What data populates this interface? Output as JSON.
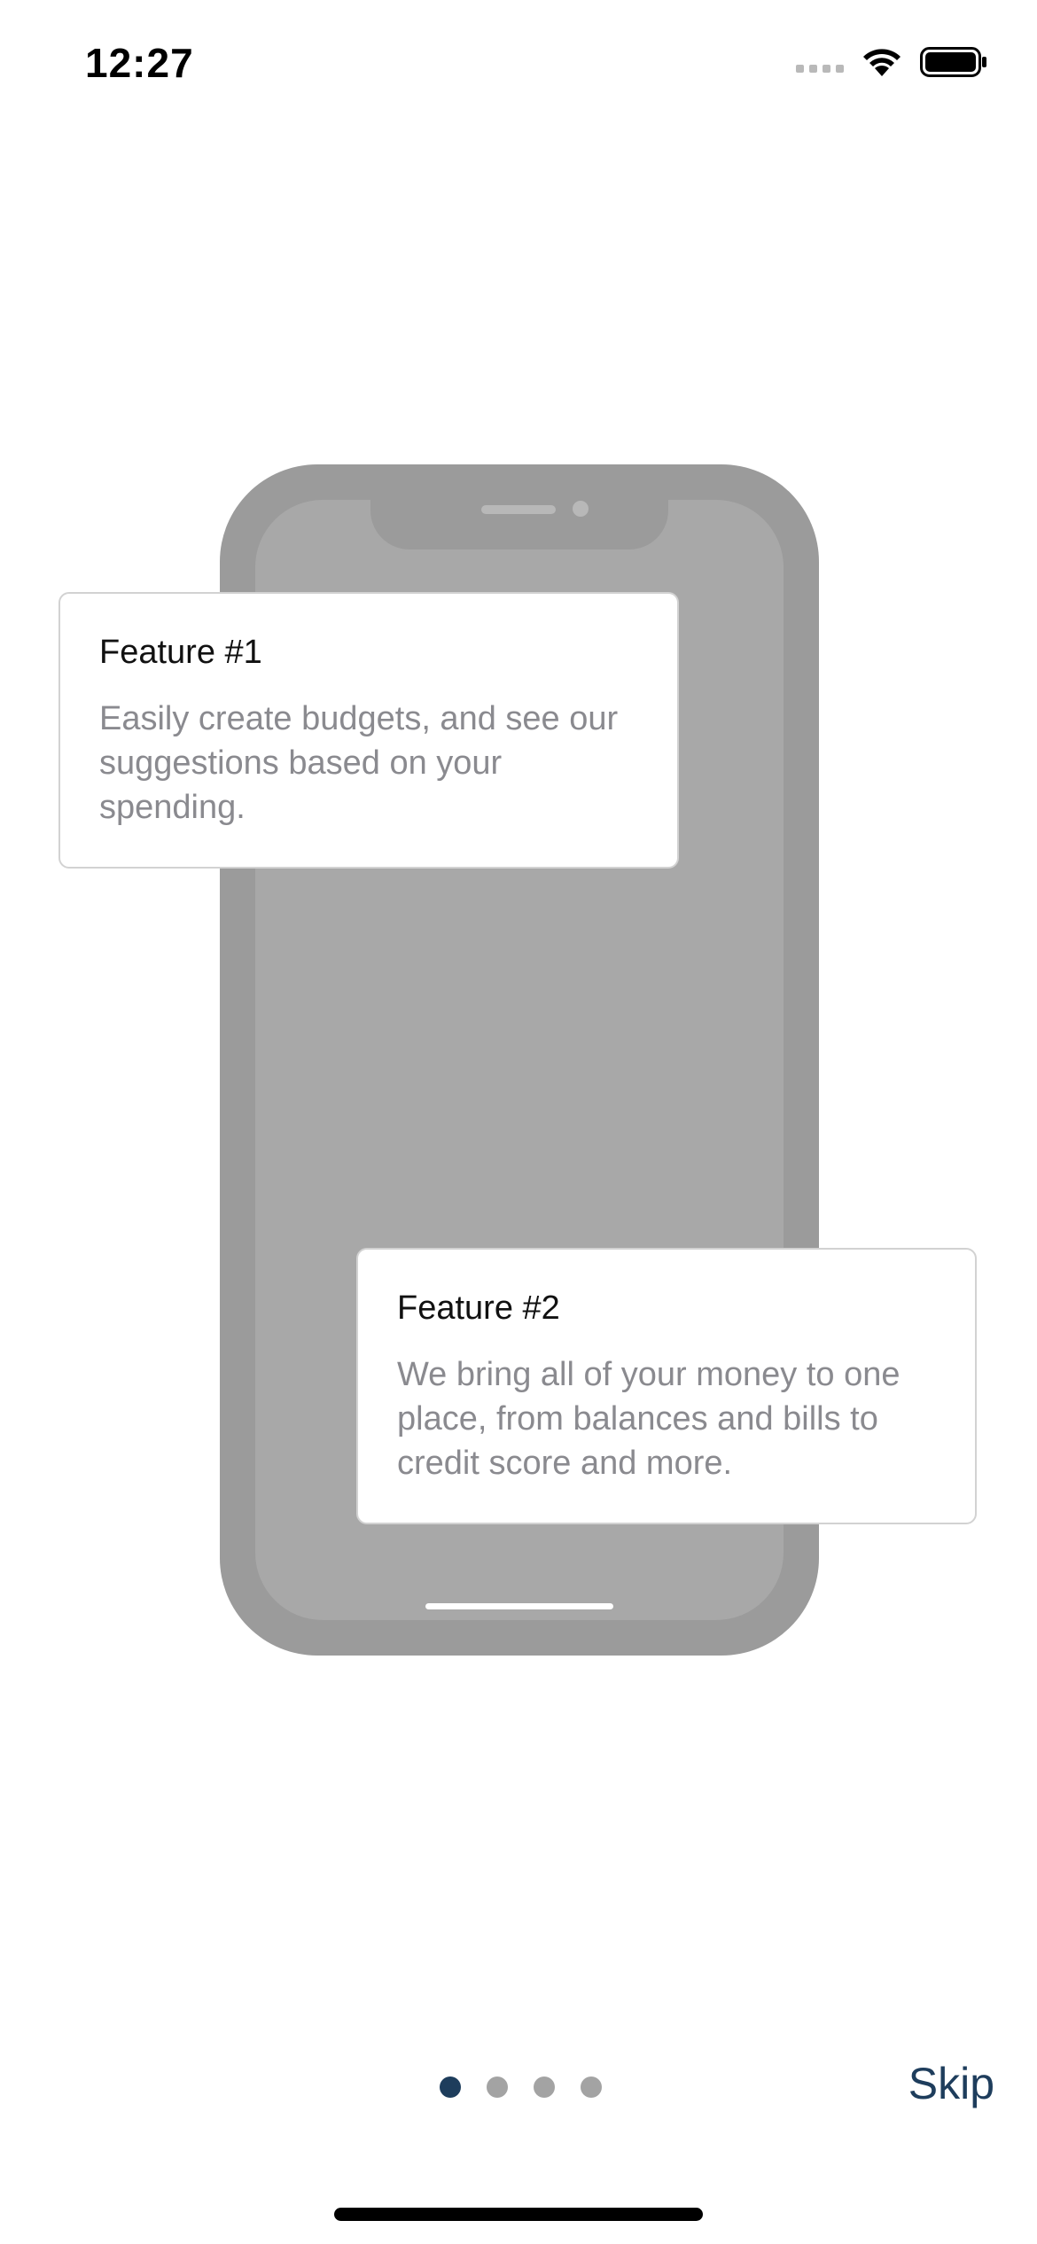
{
  "status_bar": {
    "time": "12:27",
    "icons": [
      "cellular-signal-icon",
      "wifi-icon",
      "battery-icon"
    ]
  },
  "illustration": {
    "icon": "phone-icon"
  },
  "features": [
    {
      "title": "Feature #1",
      "description": "Easily create budgets, and see our suggestions based on your spending."
    },
    {
      "title": "Feature #2",
      "description": "We bring all of your money to one place, from balances and bills to credit score and more."
    }
  ],
  "pagination": {
    "total_pages": 4,
    "current_page": 1,
    "active_color": "#1e3d5c",
    "inactive_color": "#a3a3a3"
  },
  "skip_label": "Skip",
  "accent_color": "#1e3d5c"
}
